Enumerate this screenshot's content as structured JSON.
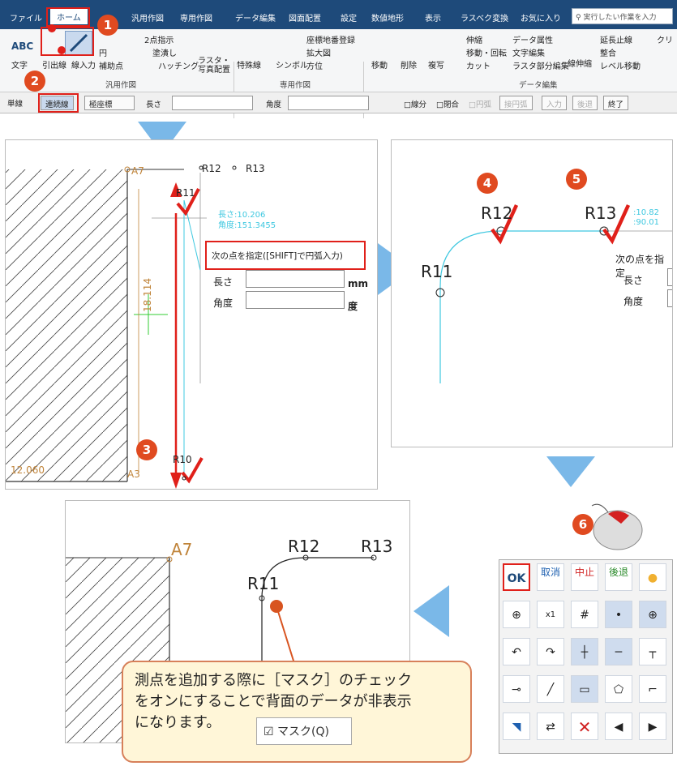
{
  "menu": {
    "tabs": [
      "ファイル",
      "ホーム",
      "汎用作図",
      "専用作図",
      "データ編集",
      "図面配置",
      "設定",
      "数値地形",
      "表示",
      "ラスベク変換",
      "お気に入り"
    ],
    "search_placeholder": "実行したい作業を入力"
  },
  "ribbon": {
    "text_btn": "文字",
    "abc": "ABC",
    "leader": "引出線",
    "line_input": "線入力",
    "two_point": "2点指示",
    "circle": "円",
    "fill": "塗潰し",
    "aux_point": "補助点",
    "hatch": "ハッチング",
    "raster": "ラスタ・写真配置",
    "special_line": "特殊線",
    "symbol": "シンボル",
    "coord_register": "座標地番登録",
    "zoom_map": "拡大図",
    "direction": "方位",
    "move": "移動",
    "delete": "削除",
    "copy": "複写",
    "extend": "伸縮",
    "move_rotate": "移動・回転",
    "cut": "カット",
    "data_attr": "データ属性",
    "text_edit": "文字編集",
    "raster_edit": "ラスタ部分編集",
    "line_extend": "線伸縮",
    "extend_stop": "延長止線",
    "align": "整合",
    "level_move": "レベル移動",
    "clear": "クリ",
    "group_general": "汎用作図",
    "group_special": "専用作図",
    "group_data": "データ編集"
  },
  "cmdbar": {
    "single": "単線",
    "continuous": "連続線",
    "coord": "極座標",
    "length": "長さ",
    "angle": "角度",
    "arc_minute": "線分",
    "closed": "閉合",
    "circle": "円弧",
    "point": "接円弧",
    "input": "入力",
    "back": "後退",
    "end": "終了"
  },
  "panel1": {
    "a7": "A7",
    "a3": "A3",
    "r10": "R10",
    "r11": "R11",
    "r12": "R12",
    "r13": "R13",
    "len_readout": "長さ:10.206",
    "ang_readout": "角度:151.3455",
    "prompt": "次の点を指定([SHIFT]で円弧入力)",
    "length": "長さ",
    "angle": "角度",
    "mm": "mm",
    "deg": "度",
    "dim_v": "18.114",
    "dim_h": "12.060"
  },
  "panel2": {
    "r11": "R11",
    "r12": "R12",
    "r13": "R13",
    "readout": ":10.82\n:90.01",
    "prompt": "次の点を指定",
    "length": "長さ",
    "angle": "角度"
  },
  "panel3": {
    "a7": "A7",
    "r11": "R11",
    "r12": "R12",
    "r13": "R13"
  },
  "badges": [
    "1",
    "2",
    "3",
    "4",
    "5",
    "6"
  ],
  "toolbar": {
    "ok": "OK",
    "cancel": "取消",
    "stop": "中止",
    "back": "後退"
  },
  "callout": {
    "line1": "測点を追加する際に［マスク］のチェック",
    "line2": "をオンにすることで背面のデータが非表示",
    "line3": "になります。",
    "mask_label": "☑ マスク(Q)"
  },
  "colors": {
    "red": "#e0201a",
    "cyan": "#3fc8e0",
    "orange": "#c0843a",
    "arrow_blue": "#7ab8e8"
  }
}
